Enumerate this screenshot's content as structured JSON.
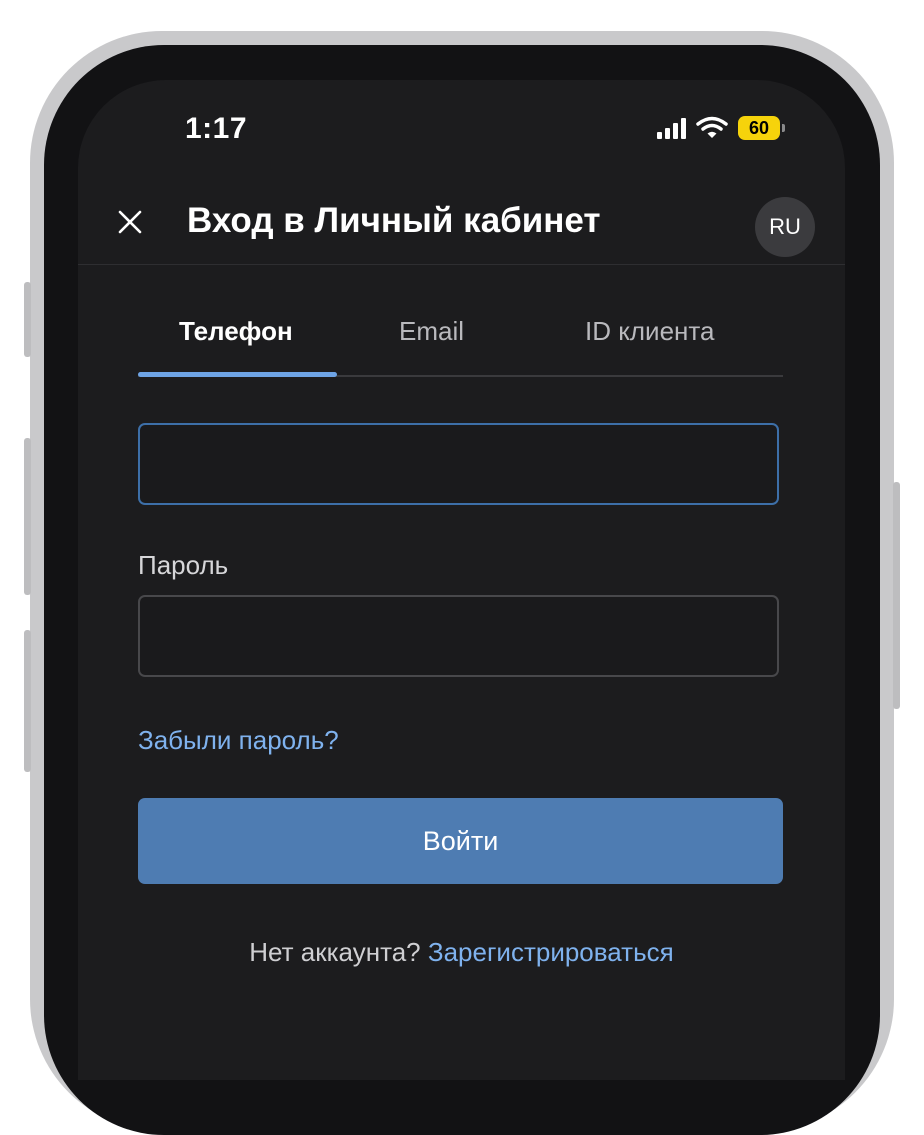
{
  "status_bar": {
    "time": "1:17",
    "battery": "60",
    "icons": [
      "signal-icon",
      "wifi-icon",
      "battery-icon"
    ]
  },
  "header": {
    "close_icon": "close-icon",
    "title": "Вход в Личный кабинет",
    "language": "RU"
  },
  "tabs": [
    {
      "label": "Телефон",
      "active": true
    },
    {
      "label": "Email",
      "active": false
    },
    {
      "label": "ID клиента",
      "active": false
    }
  ],
  "form": {
    "phone_value": "",
    "password_label": "Пароль",
    "password_value": "",
    "forgot_link": "Забыли пароль?",
    "submit_label": "Войти",
    "no_account_text": "Нет аккаунта?",
    "register_link": "Зарегистрироваться"
  },
  "colors": {
    "background": "#1c1c1e",
    "accent": "#6ea4e6",
    "button": "#4e7cb2",
    "link": "#7fb2ee",
    "battery": "#f6d30b"
  }
}
